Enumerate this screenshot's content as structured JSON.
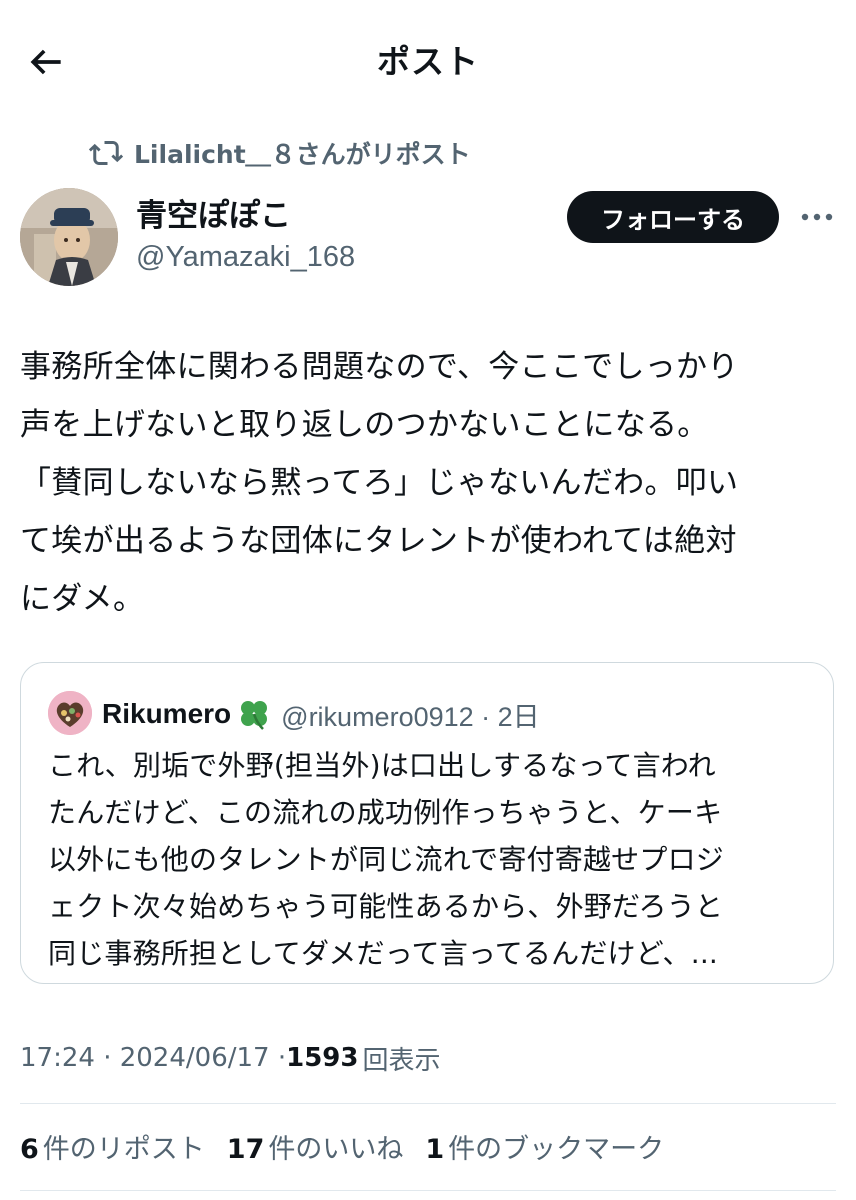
{
  "header": {
    "title": "ポスト"
  },
  "repost": {
    "text": "Lilalicht＿８さんがリポスト"
  },
  "author": {
    "name": "青空ぽぽこ",
    "handle": "@Yamazaki_168",
    "follow_label": "フォローする"
  },
  "post": {
    "lines": [
      "事務所全体に関わる問題なので、今ここでしっかり",
      "声を上げないと取り返しのつかないことになる。",
      "「賛同しないなら黙ってろ」じゃないんだわ。叩い",
      "て埃が出るような団体にタレントが使われては絶対",
      "にダメ。"
    ]
  },
  "quote": {
    "name": "Rikumero",
    "handle": "@rikumero0912 · 2日",
    "lines": [
      "これ、別垢で外野(担当外)は口出しするなって言われ",
      "たんだけど、この流れの成功例作っちゃうと、ケーキ",
      "以外にも他のタレントが同じ流れで寄付寄越せプロジ",
      "ェクト次々始めちゃう可能性あるから、外野だろうと",
      "同じ事務所担としてダメだって言ってるんだけど、..."
    ]
  },
  "meta": {
    "time_date": "17:24 · 2024/06/17 · ",
    "views_count": "1593",
    "views_label": "回表示"
  },
  "stats": {
    "reposts_count": "6",
    "reposts_label": "件のリポスト",
    "likes_count": "17",
    "likes_label": "件のいいね",
    "bookmarks_count": "1",
    "bookmarks_label": "件のブックマーク"
  },
  "colors": {
    "text_primary": "#0f1419",
    "text_secondary": "#536471",
    "follow_button_bg": "#0f1419",
    "border": "#cfd9de"
  },
  "icons": {
    "back": "arrow-left-icon",
    "repost": "repost-icon",
    "more": "more-dots-icon",
    "clover": "four-leaf-clover-icon"
  }
}
